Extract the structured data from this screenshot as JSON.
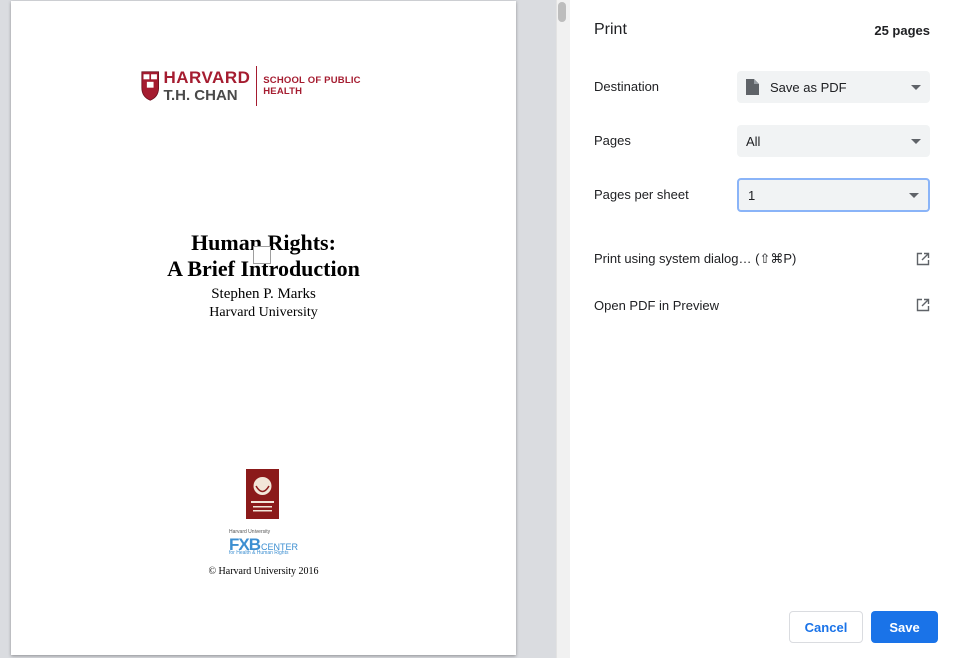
{
  "preview": {
    "logo": {
      "harvard": "HARVARD",
      "chan": "T.H. CHAN",
      "school": "SCHOOL OF PUBLIC HEALTH"
    },
    "title_line1": "Human Rights:",
    "title_line2": "A Brief Introduction",
    "author": "Stephen P. Marks",
    "affiliation": "Harvard University",
    "fxb_top": "Harvard University",
    "fxb_letters": "FXB",
    "fxb_center": "CENTER",
    "fxb_tagline": "for Health & Human Rights",
    "copyright": "© Harvard University 2016"
  },
  "panel": {
    "title": "Print",
    "page_count": "25 pages",
    "destination": {
      "label": "Destination",
      "value": "Save as PDF",
      "icon": "document-icon"
    },
    "pages": {
      "label": "Pages",
      "value": "All"
    },
    "pages_per_sheet": {
      "label": "Pages per sheet",
      "value": "1"
    },
    "system_dialog": {
      "label": "Print using system dialog… (⇧⌘P)",
      "icon": "open-external-icon"
    },
    "open_preview": {
      "label": "Open PDF in Preview",
      "icon": "open-external-icon"
    },
    "cancel_label": "Cancel",
    "save_label": "Save"
  },
  "colors": {
    "accent": "#1a73e8",
    "harvard_crimson": "#a51c30",
    "focus_ring": "#8ab4f8"
  }
}
